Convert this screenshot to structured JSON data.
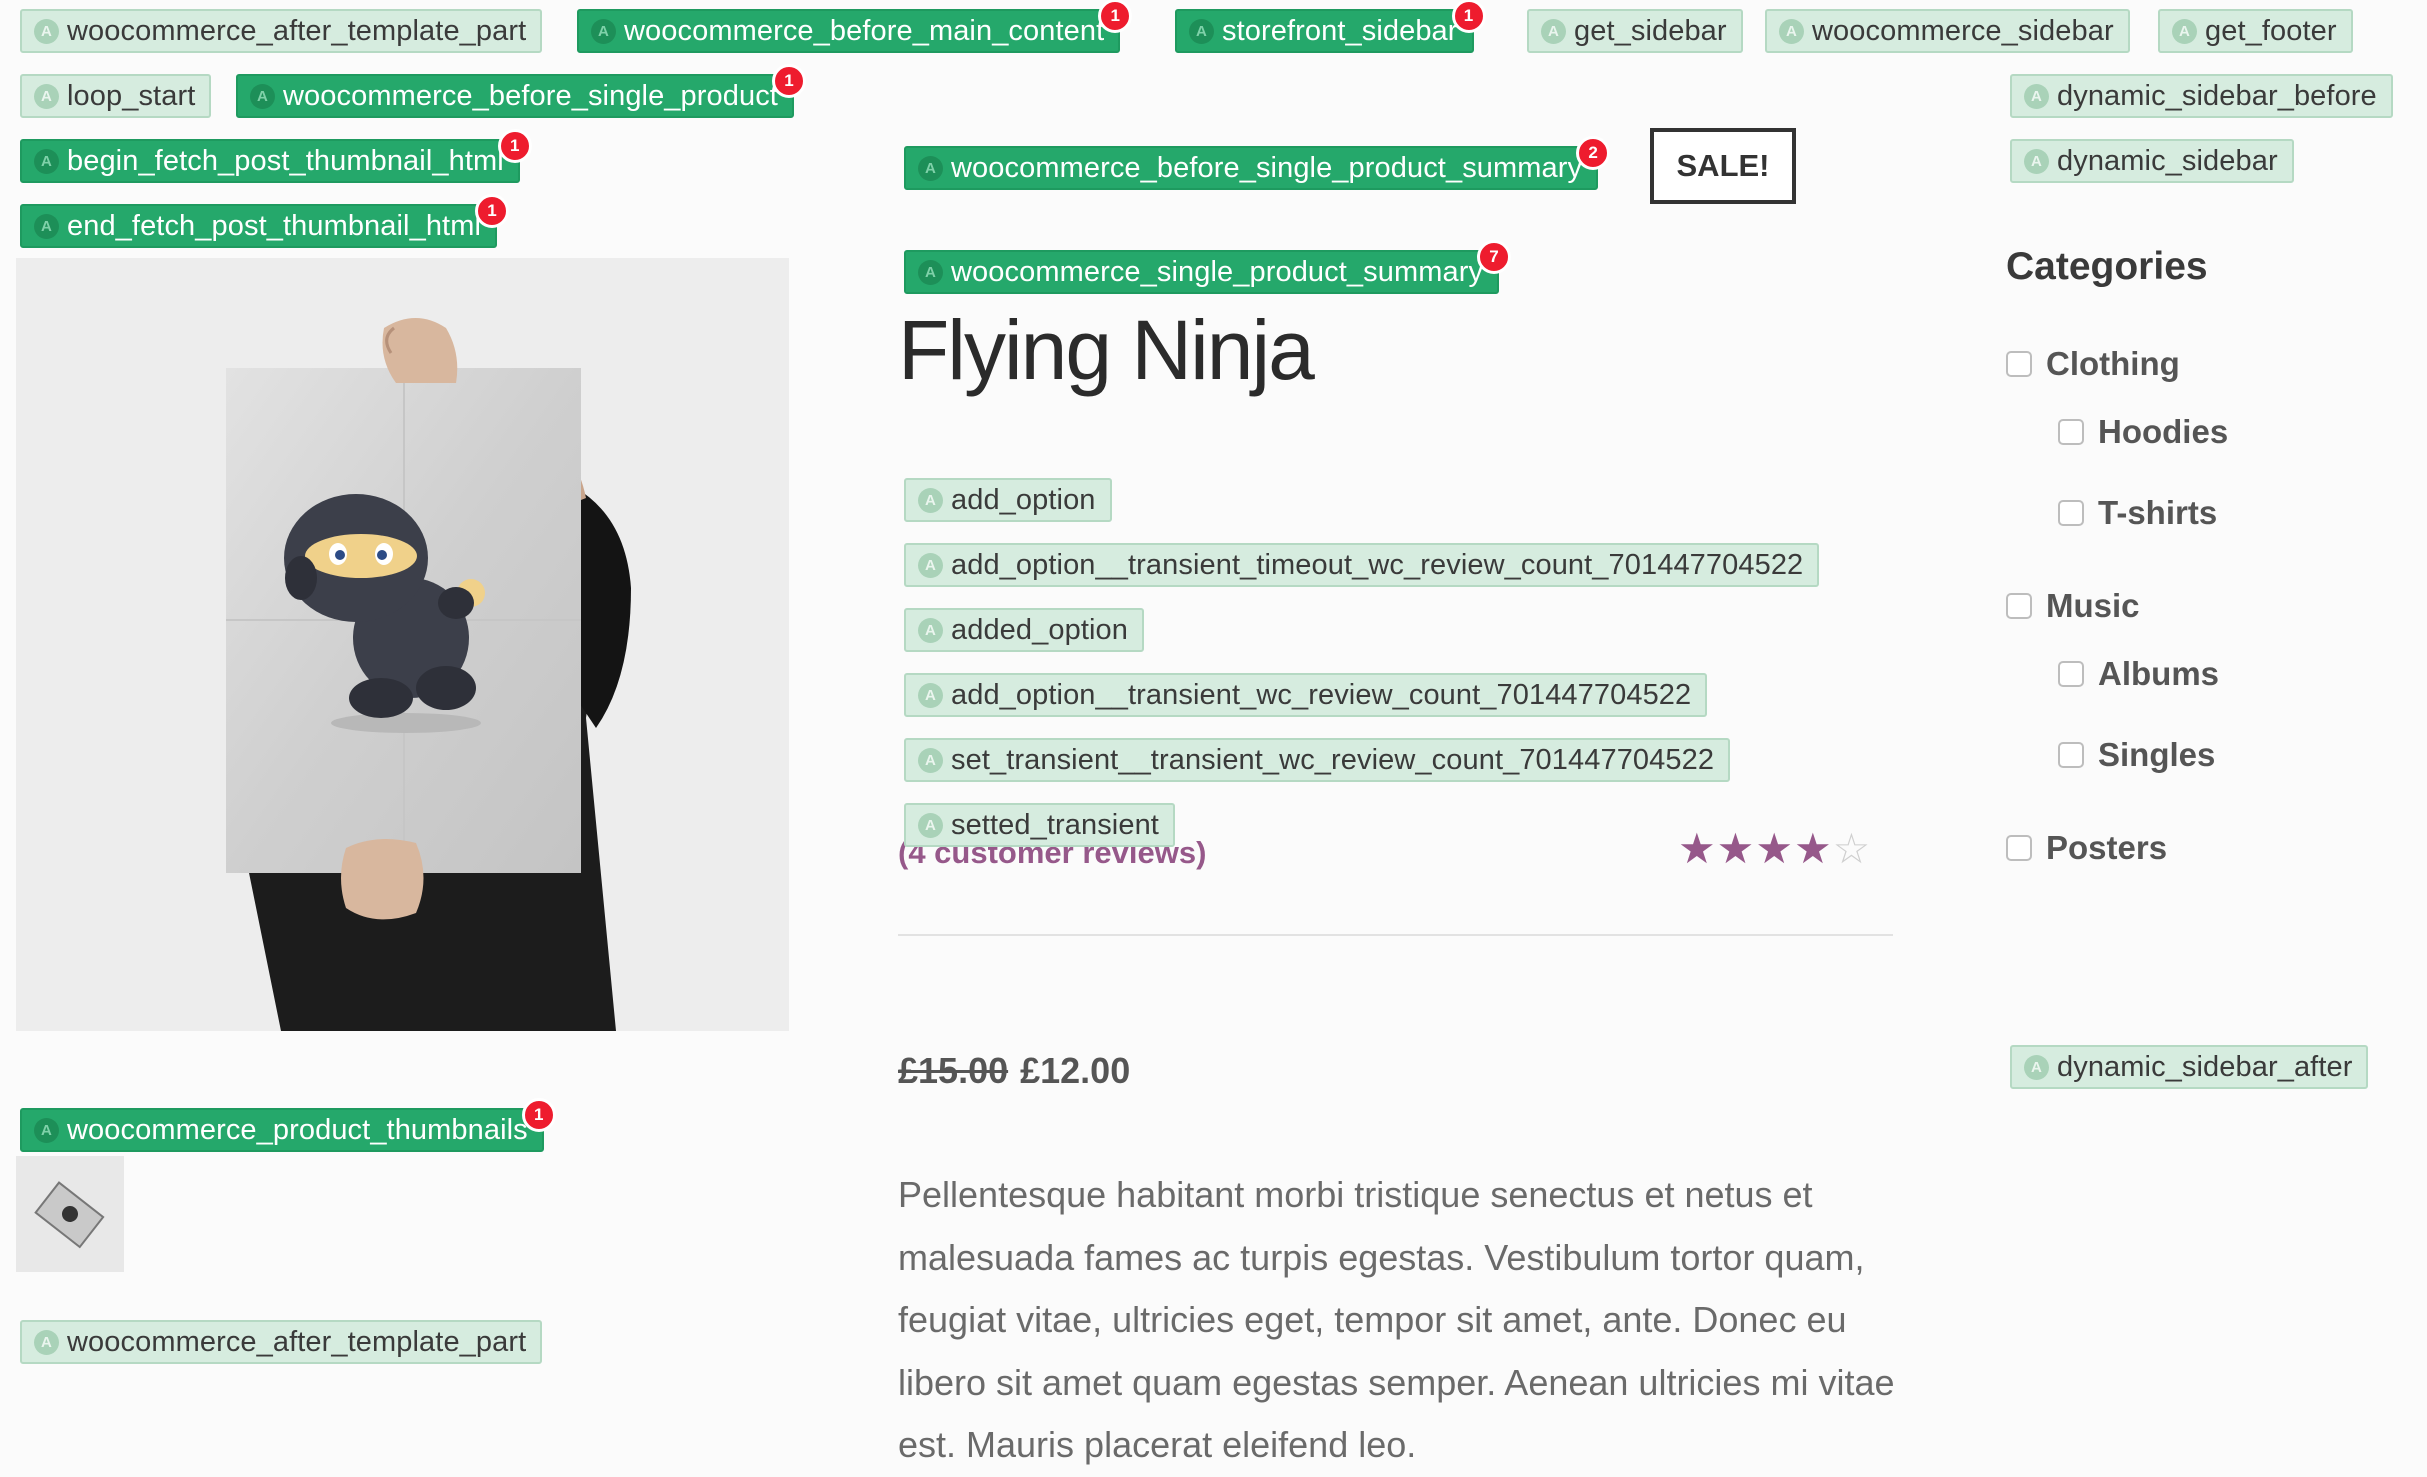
{
  "hooks": {
    "top_after_template_part": "woocommerce_after_template_part",
    "before_main_content": "woocommerce_before_main_content",
    "storefront_sidebar": "storefront_sidebar",
    "get_sidebar": "get_sidebar",
    "woocommerce_sidebar": "woocommerce_sidebar",
    "get_footer": "get_footer",
    "loop_start": "loop_start",
    "before_single_product": "woocommerce_before_single_product",
    "dynamic_sidebar_before": "dynamic_sidebar_before",
    "begin_fetch_post_thumbnail_html": "begin_fetch_post_thumbnail_html",
    "dynamic_sidebar": "dynamic_sidebar",
    "end_fetch_post_thumbnail_html": "end_fetch_post_thumbnail_html",
    "before_single_product_summary": "woocommerce_before_single_product_summary",
    "single_product_summary": "woocommerce_single_product_summary",
    "add_option": "add_option",
    "add_option_timeout": "add_option__transient_timeout_wc_review_count_701447704522",
    "added_option": "added_option",
    "add_option_transient": "add_option__transient_wc_review_count_701447704522",
    "set_transient": "set_transient__transient_wc_review_count_701447704522",
    "setted_transient": "setted_transient",
    "product_thumbnails": "woocommerce_product_thumbnails",
    "bottom_after_template_part": "woocommerce_after_template_part",
    "dynamic_sidebar_after": "dynamic_sidebar_after"
  },
  "badges": {
    "before_main_content": "1",
    "storefront_sidebar": "1",
    "before_single_product": "1",
    "begin_fetch_post_thumbnail_html": "1",
    "end_fetch_post_thumbnail_html": "1",
    "before_single_product_summary": "2",
    "single_product_summary": "7",
    "product_thumbnails": "1"
  },
  "hook_icon_letter": "A",
  "product": {
    "sale_label": "SALE!",
    "title": "Flying Ninja",
    "reviews_link": "(4 customer reviews)",
    "rating": 4,
    "rating_max": 5,
    "price_old": "£15.00",
    "price_new": "£12.00",
    "description": "Pellentesque habitant morbi tristique senectus et netus et malesuada fames ac turpis egestas. Vestibulum tortor quam, feugiat vitae, ultricies eget, tempor sit amet, ante. Donec eu libero sit amet quam egestas semper. Aenean ultricies mi vitae est. Mauris placerat eleifend leo."
  },
  "sidebar": {
    "heading": "Categories",
    "categories": [
      {
        "label": "Clothing",
        "checked": false
      },
      {
        "label": "Hoodies",
        "checked": false
      },
      {
        "label": "T-shirts",
        "checked": false
      },
      {
        "label": "Music",
        "checked": false
      },
      {
        "label": "Albums",
        "checked": false
      },
      {
        "label": "Singles",
        "checked": false
      },
      {
        "label": "Posters",
        "checked": false
      }
    ]
  },
  "colors": {
    "hook_light": "#d6ecdf",
    "hook_dark": "#25a86b",
    "badge": "#ee1c2e",
    "accent": "#96588a"
  },
  "icons": {
    "hook_icon": "a-circle-icon",
    "star": "star-icon",
    "checkbox": "checkbox-icon"
  }
}
